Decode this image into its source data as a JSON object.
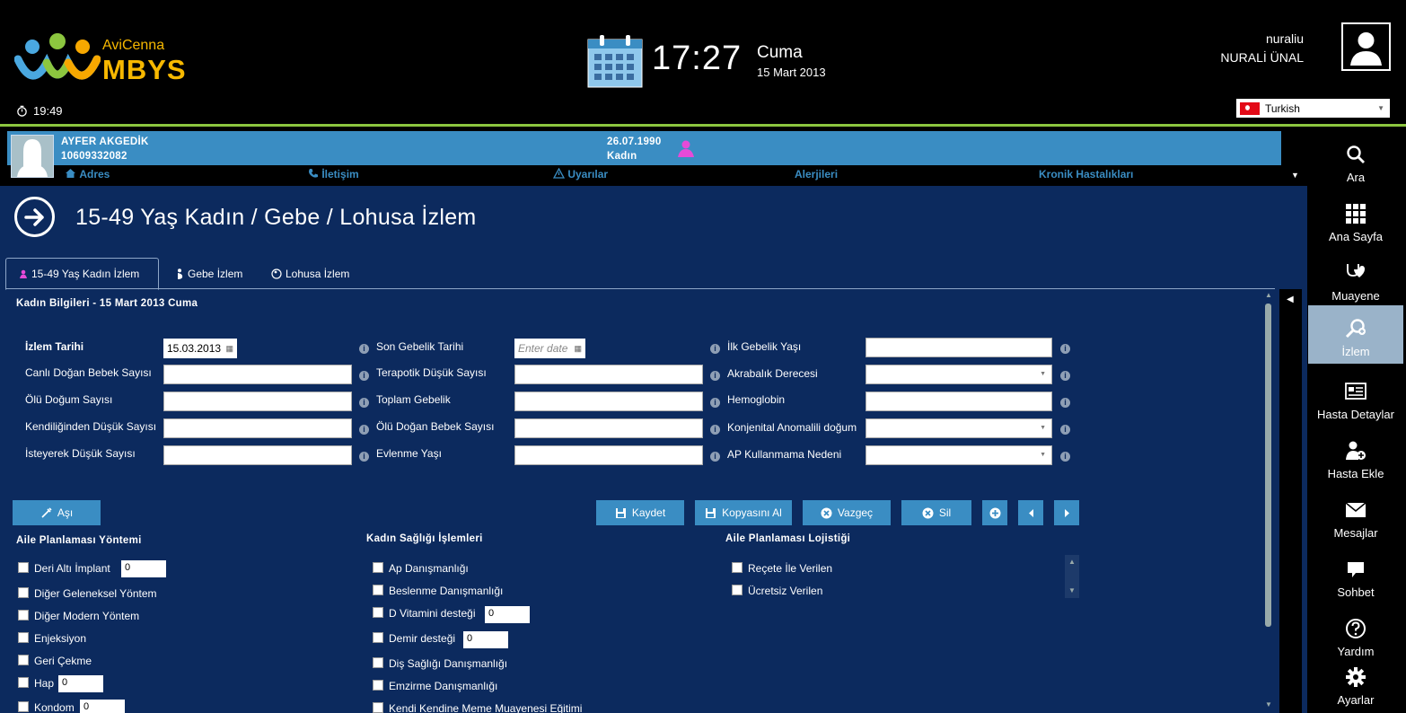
{
  "header": {
    "logo_top": "AviCenna",
    "logo_main": "MBYS",
    "timer": "19:49",
    "clock": "17:27",
    "day": "Cuma",
    "date": "15 Mart 2013",
    "username": "nuraliu",
    "fullname": "NURALİ ÜNAL",
    "language": "Turkish"
  },
  "patient": {
    "name": "AYFER AKGEDİK",
    "id": "10609332082",
    "dob": "26.07.1990",
    "gender": "Kadın",
    "links": [
      "Adres",
      "İletişim",
      "Uyarılar",
      "Alerjileri",
      "Kronik Hastalıkları"
    ]
  },
  "page": {
    "title": "15-49 Yaş Kadın / Gebe / Lohusa İzlem",
    "tabs": [
      "15-49 Yaş Kadın İzlem",
      "Gebe İzlem",
      "Lohusa İzlem"
    ],
    "section_title": "Kadın Bilgileri - 15 Mart 2013 Cuma"
  },
  "form": {
    "col1": [
      {
        "label": "İzlem Tarihi",
        "value": "15.03.2013"
      },
      {
        "label": "Canlı Doğan Bebek Sayısı"
      },
      {
        "label": "Ölü Doğum Sayısı"
      },
      {
        "label": "Kendiliğinden Düşük Sayısı"
      },
      {
        "label": "İsteyerek Düşük Sayısı"
      }
    ],
    "col2": [
      {
        "label": "Son Gebelik Tarihi",
        "placeholder": "Enter date"
      },
      {
        "label": "Terapotik Düşük Sayısı"
      },
      {
        "label": "Toplam Gebelik"
      },
      {
        "label": "Ölü Doğan Bebek Sayısı"
      },
      {
        "label": "Evlenme Yaşı"
      }
    ],
    "col3": [
      {
        "label": "İlk Gebelik Yaşı"
      },
      {
        "label": "Akrabalık Derecesi"
      },
      {
        "label": "Hemoglobin"
      },
      {
        "label": "Konjenital Anomalili doğum"
      },
      {
        "label": "AP Kullanmama Nedeni"
      }
    ]
  },
  "buttons": {
    "asi": "Aşı",
    "kaydet": "Kaydet",
    "kopya": "Kopyasını Al",
    "vazgec": "Vazgeç",
    "sil": "Sil"
  },
  "lists": {
    "ap_title": "Aile Planlaması Yöntemi",
    "ap_items": [
      {
        "label": "Deri Altı İmplant",
        "value": "0"
      },
      {
        "label": "Diğer Geleneksel Yöntem"
      },
      {
        "label": "Diğer Modern Yöntem"
      },
      {
        "label": "Enjeksiyon"
      },
      {
        "label": "Geri Çekme"
      },
      {
        "label": "Hap",
        "value": "0"
      },
      {
        "label": "Kondom",
        "value": "0"
      }
    ],
    "ks_title": "Kadın Sağlığı İşlemleri",
    "ks_items": [
      {
        "label": "Ap Danışmanlığı"
      },
      {
        "label": "Beslenme Danışmanlığı"
      },
      {
        "label": "D Vitamini desteği",
        "value": "0"
      },
      {
        "label": "Demir desteği",
        "value": "0"
      },
      {
        "label": "Diş Sağlığı Danışmanlığı"
      },
      {
        "label": "Emzirme Danışmanlığı"
      },
      {
        "label": "Kendi Kendine Meme Muayenesi Eğitimi"
      }
    ],
    "apl_title": "Aile Planlaması Lojistiği",
    "apl_items": [
      {
        "label": "Reçete İle Verilen"
      },
      {
        "label": "Ücretsiz Verilen"
      }
    ]
  },
  "sidebar": [
    {
      "label": "Ara",
      "icon": "search-icon"
    },
    {
      "label": "Ana Sayfa",
      "icon": "grid-icon"
    },
    {
      "label": "Muayene",
      "icon": "stethoscope-icon"
    },
    {
      "label": "İzlem",
      "icon": "monitor-search-icon"
    },
    {
      "label": "Hasta Detaylar",
      "icon": "id-card-icon"
    },
    {
      "label": "Hasta Ekle",
      "icon": "add-user-icon"
    },
    {
      "label": "Mesajlar",
      "icon": "mail-icon"
    },
    {
      "label": "Sohbet",
      "icon": "chat-icon"
    },
    {
      "label": "Yardım",
      "icon": "help-icon"
    },
    {
      "label": "Ayarlar",
      "icon": "gear-icon"
    }
  ],
  "colors": {
    "accent": "#3a8dc3",
    "main_bg": "#0c2a5e",
    "lime": "#8cc63f",
    "selected_nav": "#9ab3c9"
  }
}
